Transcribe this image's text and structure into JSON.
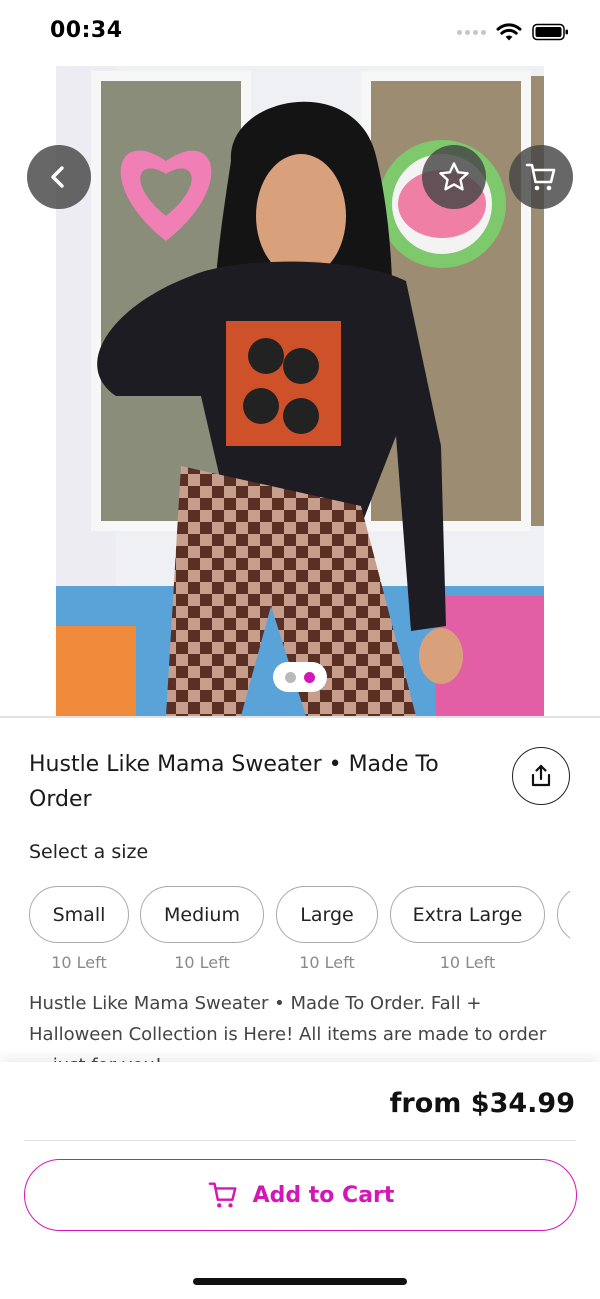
{
  "status_bar": {
    "time": "00:34"
  },
  "colors": {
    "accent": "#d516b6",
    "overlay_button": "#464646",
    "dot_inactive": "#b9b9b9",
    "dot_active": "#d516b6"
  },
  "hero": {
    "icons": {
      "back": "chevron-left-icon",
      "favorite": "star-icon",
      "cart": "cart-icon"
    },
    "carousel": {
      "count": 2,
      "active_index": 1
    }
  },
  "product": {
    "title": "Hustle Like Mama Sweater • Made To Order",
    "share_icon": "share-icon"
  },
  "size_section": {
    "label": "Select a size",
    "sizes": [
      {
        "label": "Small",
        "stock": "10 Left"
      },
      {
        "label": "Medium",
        "stock": "10 Left"
      },
      {
        "label": "Large",
        "stock": "10 Left"
      },
      {
        "label": "Extra Large",
        "stock": "10 Left"
      }
    ]
  },
  "description": {
    "text": "Hustle Like Mama Sweater • Made To Order. Fall + Halloween Collection is Here! All items are made to order — just for you!"
  },
  "purchase_bar": {
    "price": "from $34.99",
    "add_to_cart_label": "Add to Cart"
  }
}
